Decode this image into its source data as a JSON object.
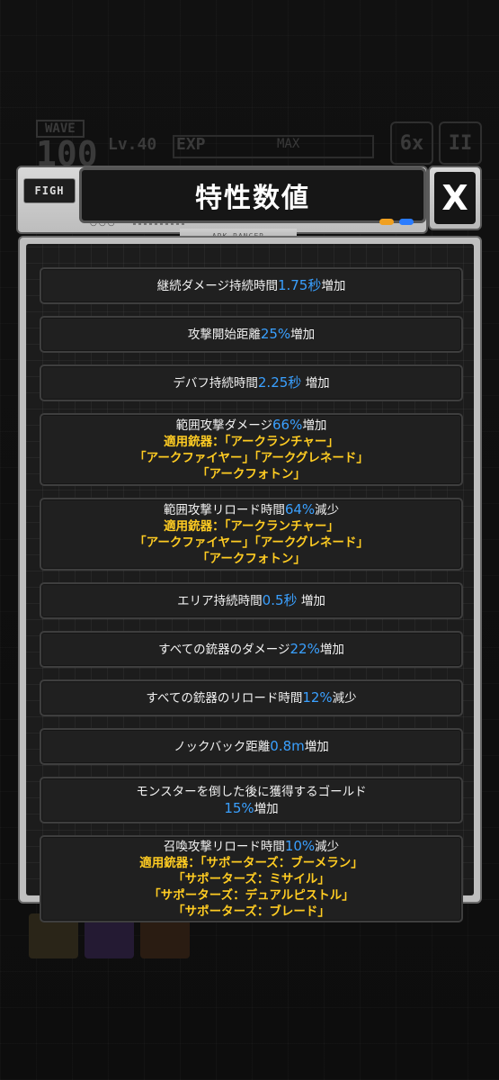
{
  "background": {
    "wave_label": "WAVE",
    "wave_number": "100",
    "level": "Lv.40",
    "exp_label": "EXP",
    "exp_max": "MAX",
    "speed": "6x",
    "pause": "II"
  },
  "header": {
    "tag": "FIGH",
    "title": "特性数値",
    "plate_label": "ARK RANGER",
    "close": "X"
  },
  "colors": {
    "value_blue": "#3aa0ff",
    "weapon_yellow": "#ffcc22",
    "led_orange": "#f0a020",
    "led_blue": "#2a7cff"
  },
  "items": [
    {
      "pre": "継続ダメージ持続時間",
      "value": "1.75秒",
      "post": "増加"
    },
    {
      "pre": "攻撃開始距離",
      "value": "25%",
      "post": "増加"
    },
    {
      "pre": "デバフ持続時間",
      "value": "2.25秒",
      "post": " 増加"
    },
    {
      "pre": "範囲攻撃ダメージ",
      "value": "66%",
      "post": "増加",
      "weapons": [
        "適用銃器：「アークランチャー」",
        "「アークファイヤー」「アークグレネード」",
        "「アークフォトン」"
      ]
    },
    {
      "pre": "範囲攻撃リロード時間",
      "value": "64%",
      "post": "減少",
      "weapons": [
        "適用銃器：「アークランチャー」",
        "「アークファイヤー」「アークグレネード」",
        "「アークフォトン」"
      ]
    },
    {
      "pre": "エリア持続時間",
      "value": "0.5秒",
      "post": " 増加"
    },
    {
      "pre": "すべての銃器のダメージ",
      "value": "22%",
      "post": "増加"
    },
    {
      "pre": "すべての銃器のリロード時間",
      "value": "12%",
      "post": "減少"
    },
    {
      "pre": "ノックバック距離",
      "value": "0.8m",
      "post": "増加"
    },
    {
      "pre": "モンスターを倒した後に獲得するゴールド",
      "value": "15%",
      "post": "増加",
      "value_on_new_line": true
    },
    {
      "pre": "召喚攻撃リロード時間",
      "value": "10%",
      "post": "減少",
      "weapons": [
        "適用銃器：「サポーターズ：ブーメラン」",
        "「サポーターズ：ミサイル」",
        "「サポーターズ：デュアルピストル」",
        "「サポーターズ：ブレード」"
      ]
    }
  ]
}
